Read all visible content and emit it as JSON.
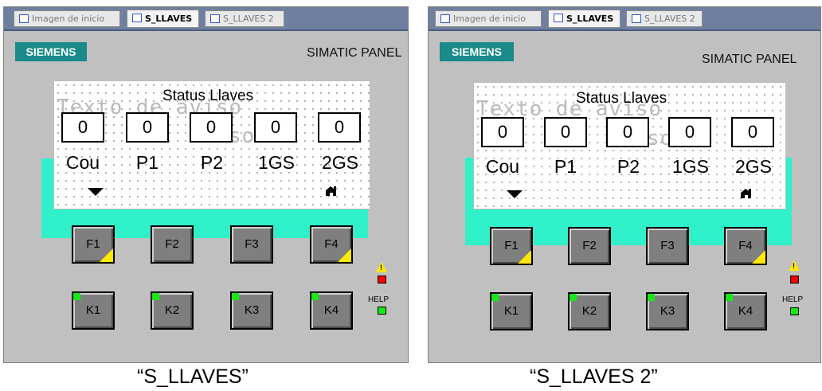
{
  "panels": [
    {
      "tabs": [
        "Imagen de inicio",
        "S_LLAVES",
        "S_LLAVES 2"
      ],
      "active_tab": 1,
      "logo": "SIEMENS",
      "brand": "SIMATIC PANEL",
      "screen_title": "Status Llaves",
      "ghost_text": [
        "Texto de aviso",
        "aviso"
      ],
      "keys": [
        {
          "value": "0",
          "label": "Cou"
        },
        {
          "value": "0",
          "label": "P1"
        },
        {
          "value": "0",
          "label": "P2"
        },
        {
          "value": "0",
          "label": "1GS"
        },
        {
          "value": "0",
          "label": "2GS"
        }
      ],
      "fkeys": [
        "F1",
        "F2",
        "F3",
        "F4"
      ],
      "kkeys": [
        "K1",
        "K2",
        "K3",
        "K4"
      ],
      "help": "HELP",
      "caption": "“S_LLAVES”"
    },
    {
      "tabs": [
        "Imagen de inicio",
        "S_LLAVES",
        "S_LLAVES 2"
      ],
      "active_tab": 1,
      "logo": "SIEMENS",
      "brand": "SIMATIC PANEL",
      "screen_title": "Status Llaves",
      "ghost_text": [
        "Texto de aviso",
        "aviso"
      ],
      "keys": [
        {
          "value": "0",
          "label": "Cou"
        },
        {
          "value": "0",
          "label": "P1"
        },
        {
          "value": "0",
          "label": "P2"
        },
        {
          "value": "0",
          "label": "1GS"
        },
        {
          "value": "0",
          "label": "2GS"
        }
      ],
      "fkeys": [
        "F1",
        "F2",
        "F3",
        "F4"
      ],
      "kkeys": [
        "K1",
        "K2",
        "K3",
        "K4"
      ],
      "help": "HELP",
      "caption": "“S_LLAVES 2”"
    }
  ],
  "colors": {
    "logo": "#1a8a8a",
    "cyan": "#2ff0c9",
    "key_led": "#17e817",
    "fkey_corner": "#ffe800",
    "tabbar": "#6f7fa0"
  },
  "icons": {
    "screen_arrow": "triangle-down-icon",
    "screen_right": "house-icon",
    "warning": "warning-icon"
  }
}
